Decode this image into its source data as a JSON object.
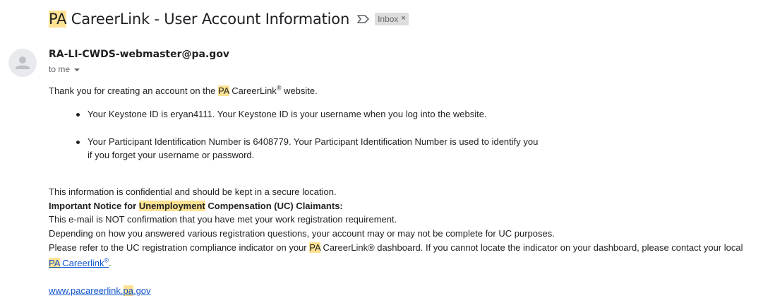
{
  "subject": {
    "pre": "PA",
    "rest": " CareerLink - User Account Information",
    "label": "Inbox",
    "label_close": "×"
  },
  "sender": {
    "from": "RA-LI-CWDS-webmaster@pa.gov",
    "to": "to me"
  },
  "body": {
    "intro_a": "Thank you for creating an account on the ",
    "intro_pa": "PA",
    "intro_b": " CareerLink",
    "intro_reg": "®",
    "intro_c": " website.",
    "bullet1": "Your Keystone ID is eryan4111. Your Keystone ID is your username when you log into the website.",
    "bullet2_line1": "Your Participant Identification Number is 6408779. Your Participant Identification Number is used to identify you",
    "bullet2_line2": "if you forget your username or password.",
    "confidential": "This information is confidential and should be kept in a secure location.",
    "notice_a": "Important Notice for ",
    "notice_hl": "Unemployment",
    "notice_b": " Compensation (UC) Claimants:",
    "not_confirmation": "This e-mail is NOT confirmation that you have met your work registration requirement.",
    "depending": "Depending on how you answered various registration questions, your account may or may not be complete for UC purposes.",
    "refer_a": "Please refer to the UC registration compliance indicator on your ",
    "refer_pa": "PA",
    "refer_b": " CareerLink® dashboard. If you cannot locate the indicator on your dashboard, please contact your local",
    "local_link_pa": "PA",
    "local_link_rest": " Careerlink",
    "local_link_reg": "®",
    "local_period": ".",
    "site_a": "www.pacareerlink.",
    "site_pa": "pa",
    "site_b": ".gov"
  },
  "icons": {
    "important": "important-marker-icon",
    "avatar": "person-avatar-icon",
    "caret": "caret-down-icon"
  },
  "colors": {
    "highlight": "#fde293",
    "link": "#1155cc",
    "chip": "#dddddd"
  }
}
